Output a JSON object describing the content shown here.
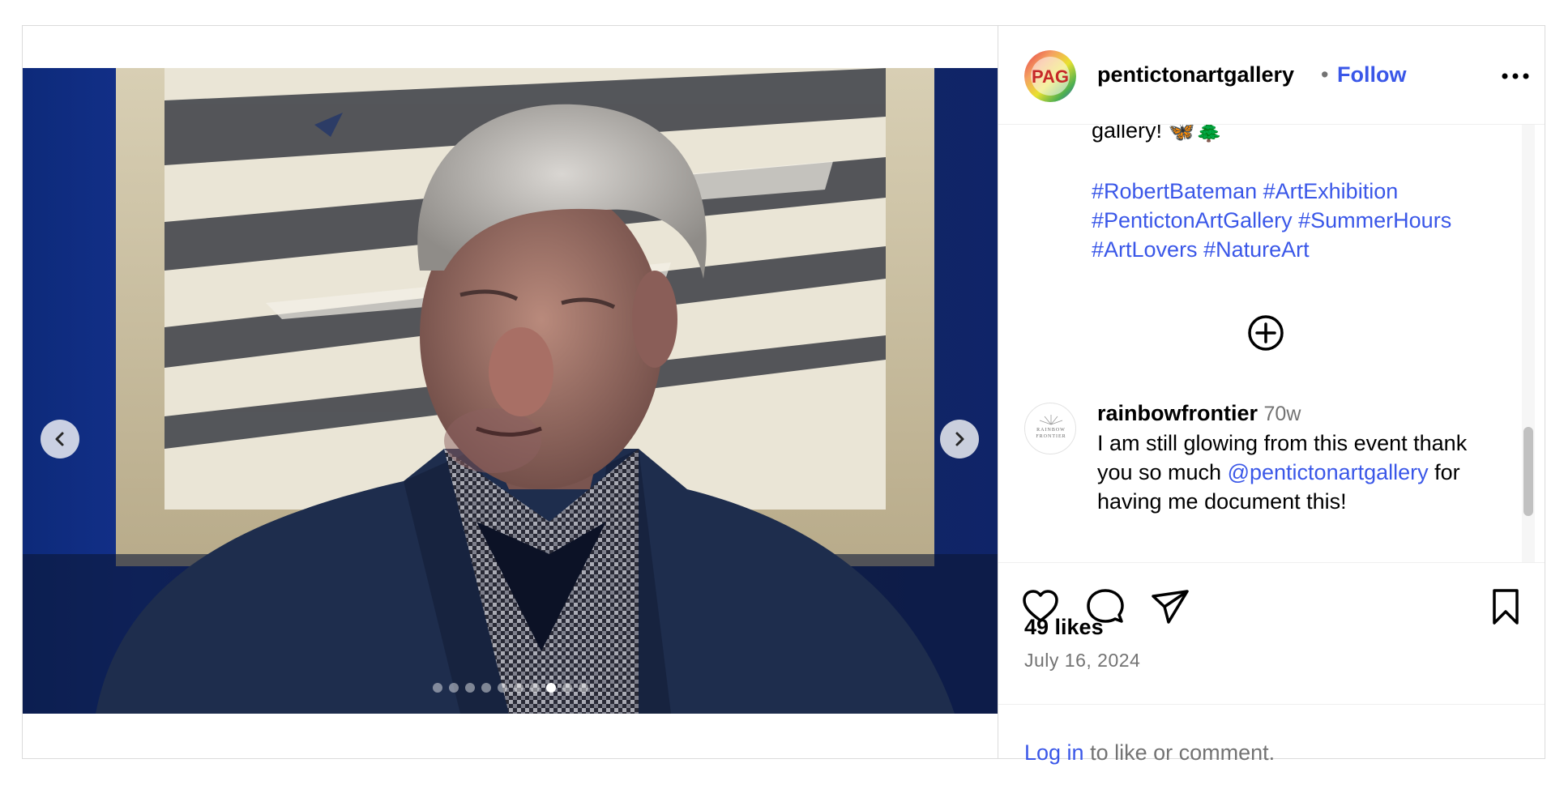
{
  "post": {
    "author": "pentictonartgallery",
    "separator": "•",
    "follow_label": "Follow",
    "avatar_text": "PAG",
    "caption_tail": "gallery! 🦋🌲",
    "hashtags": [
      "#RobertBateman",
      "#ArtExhibition",
      "#PentictonArtGallery",
      "#SummerHours",
      "#ArtLovers",
      "#NatureArt"
    ],
    "likes": "49 likes",
    "date": "July 16, 2024"
  },
  "carousel": {
    "total_slides": 10,
    "active_index": 7
  },
  "comments": [
    {
      "user": "rainbowfrontier",
      "time": "70w",
      "text_before": "I am still glowing from this event thank you so much",
      "mention": "@pentictonartgallery",
      "text_after": "for having me document this!",
      "avatar_text": "RAINBOW FRONTIER"
    }
  ],
  "footer": {
    "login_link": "Log in",
    "login_text": "to like or comment."
  },
  "colors": {
    "link": "#3a57e8",
    "muted": "#737373",
    "border": "#dbdbdb"
  },
  "icons": {
    "prev": "chevron-left-icon",
    "next": "chevron-right-icon",
    "more": "more-horizontal-icon",
    "load_more": "plus-circle-icon",
    "like": "heart-icon",
    "comment": "comment-bubble-icon",
    "share": "paper-plane-icon",
    "save": "bookmark-icon"
  }
}
